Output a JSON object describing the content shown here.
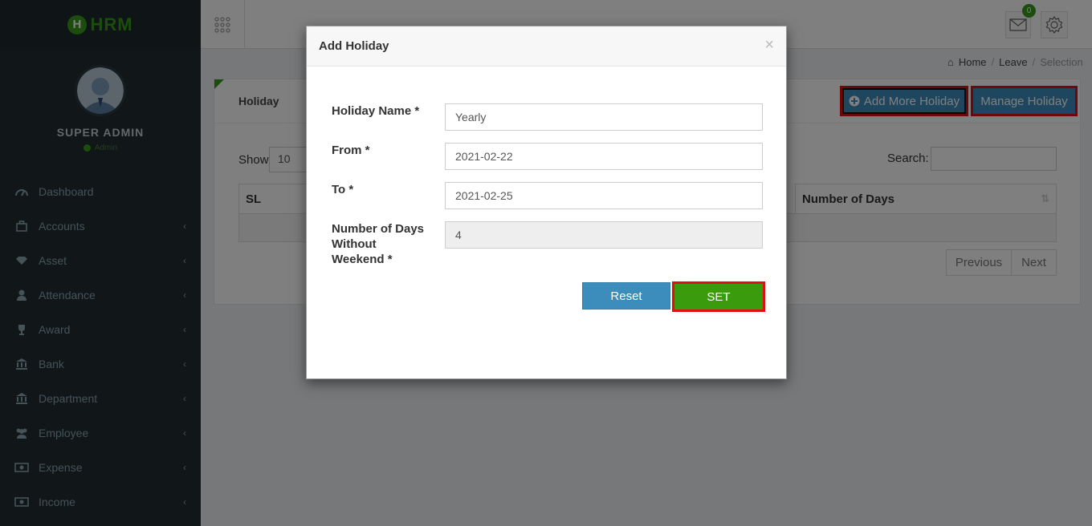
{
  "brand": {
    "logo_letter": "H",
    "logo_text": "HRM",
    "accent": "#3a9b1c"
  },
  "user": {
    "name": "SUPER ADMIN",
    "role": "Admin"
  },
  "sidebar": {
    "items": [
      {
        "label": "Dashboard",
        "icon": "dashboard-icon",
        "has_submenu": false
      },
      {
        "label": "Accounts",
        "icon": "briefcase-icon",
        "has_submenu": true
      },
      {
        "label": "Asset",
        "icon": "diamond-icon",
        "has_submenu": true
      },
      {
        "label": "Attendance",
        "icon": "user-icon",
        "has_submenu": true
      },
      {
        "label": "Award",
        "icon": "trophy-icon",
        "has_submenu": true
      },
      {
        "label": "Bank",
        "icon": "bank-icon",
        "has_submenu": true
      },
      {
        "label": "Department",
        "icon": "building-icon",
        "has_submenu": true
      },
      {
        "label": "Employee",
        "icon": "users-icon",
        "has_submenu": true
      },
      {
        "label": "Expense",
        "icon": "money-icon",
        "has_submenu": true
      },
      {
        "label": "Income",
        "icon": "money-icon",
        "has_submenu": true
      }
    ]
  },
  "header": {
    "mail_count": "0"
  },
  "breadcrumb": {
    "home": "Home",
    "leave": "Leave",
    "current": "Selection"
  },
  "box": {
    "title": "Holiday",
    "add_more_label": "Add More Holiday",
    "manage_label": "Manage Holiday",
    "show_label": "Show",
    "show_value": "10",
    "search_label": "Search:",
    "columns": [
      "SL",
      "Number of Days"
    ],
    "pager": {
      "previous": "Previous",
      "next": "Next"
    }
  },
  "modal": {
    "title": "Add Holiday",
    "close": "×",
    "fields": {
      "holiday_name": {
        "label": "Holiday Name *",
        "value": "Yearly"
      },
      "from": {
        "label": "From *",
        "value": "2021-02-22"
      },
      "to": {
        "label": "To *",
        "value": "2021-02-25"
      },
      "days": {
        "label": "Number of Days Without Weekend *",
        "value": "4"
      }
    },
    "reset_label": "Reset",
    "set_label": "SET"
  }
}
